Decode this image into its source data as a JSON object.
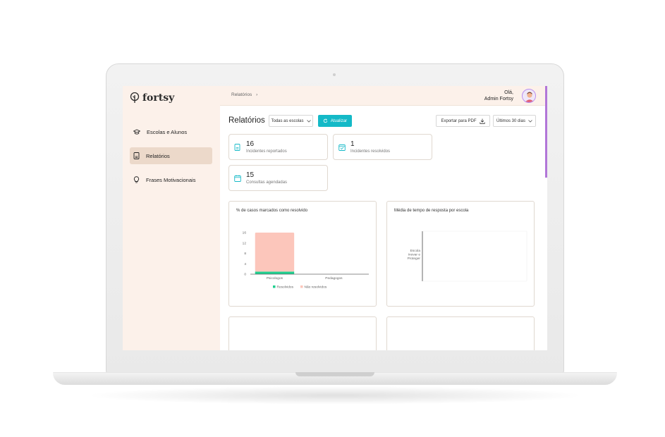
{
  "app": {
    "name": "fortsy"
  },
  "sidebar": {
    "items": [
      {
        "label": "Escolas e Alunos",
        "icon": "graduation-cap-icon",
        "active": false
      },
      {
        "label": "Relatórios",
        "icon": "document-icon",
        "active": true
      },
      {
        "label": "Frases Motivacionais",
        "icon": "lightbulb-icon",
        "active": false
      }
    ]
  },
  "topbar": {
    "breadcrumb": "Relatórios",
    "breadcrumb_sep": "›",
    "greeting": "Olá,",
    "user_name": "Admin Fortsy"
  },
  "toolbar": {
    "title": "Relatórios",
    "school_filter": "Todas as escolas",
    "refresh_label": "Atualizar",
    "export_label": "Exportar para PDF",
    "period_filter": "Últimos 30 dias"
  },
  "stats": [
    {
      "value": "16",
      "label": "Incidentes reportados"
    },
    {
      "value": "1",
      "label": "Incidentes resolvidos"
    },
    {
      "value": "15",
      "label": "Consultas agendadas"
    }
  ],
  "colors": {
    "accent": "#14b9c7",
    "sidebar_bg": "#fcf1ea",
    "resolved": "#1fcf8f",
    "unresolved": "#fcc6bb",
    "scroll": "#b276d8"
  },
  "charts": {
    "resolved_title": "% de casos marcados como resolvido",
    "response_title": "Média de tempo de resposta por escola",
    "response_category": [
      "Escola",
      "Inovar e",
      "Proteger"
    ]
  },
  "chart_data": {
    "type": "bar",
    "categories": [
      "Psicologos",
      "Pedagogos"
    ],
    "series": [
      {
        "name": "Resolvidos",
        "values": [
          1,
          0
        ]
      },
      {
        "name": "Não resolvidos",
        "values": [
          15,
          0
        ]
      }
    ],
    "stacked": true,
    "yticks": [
      0,
      4,
      8,
      12,
      16
    ],
    "ylim": [
      0,
      16
    ],
    "legend": "bottom"
  }
}
